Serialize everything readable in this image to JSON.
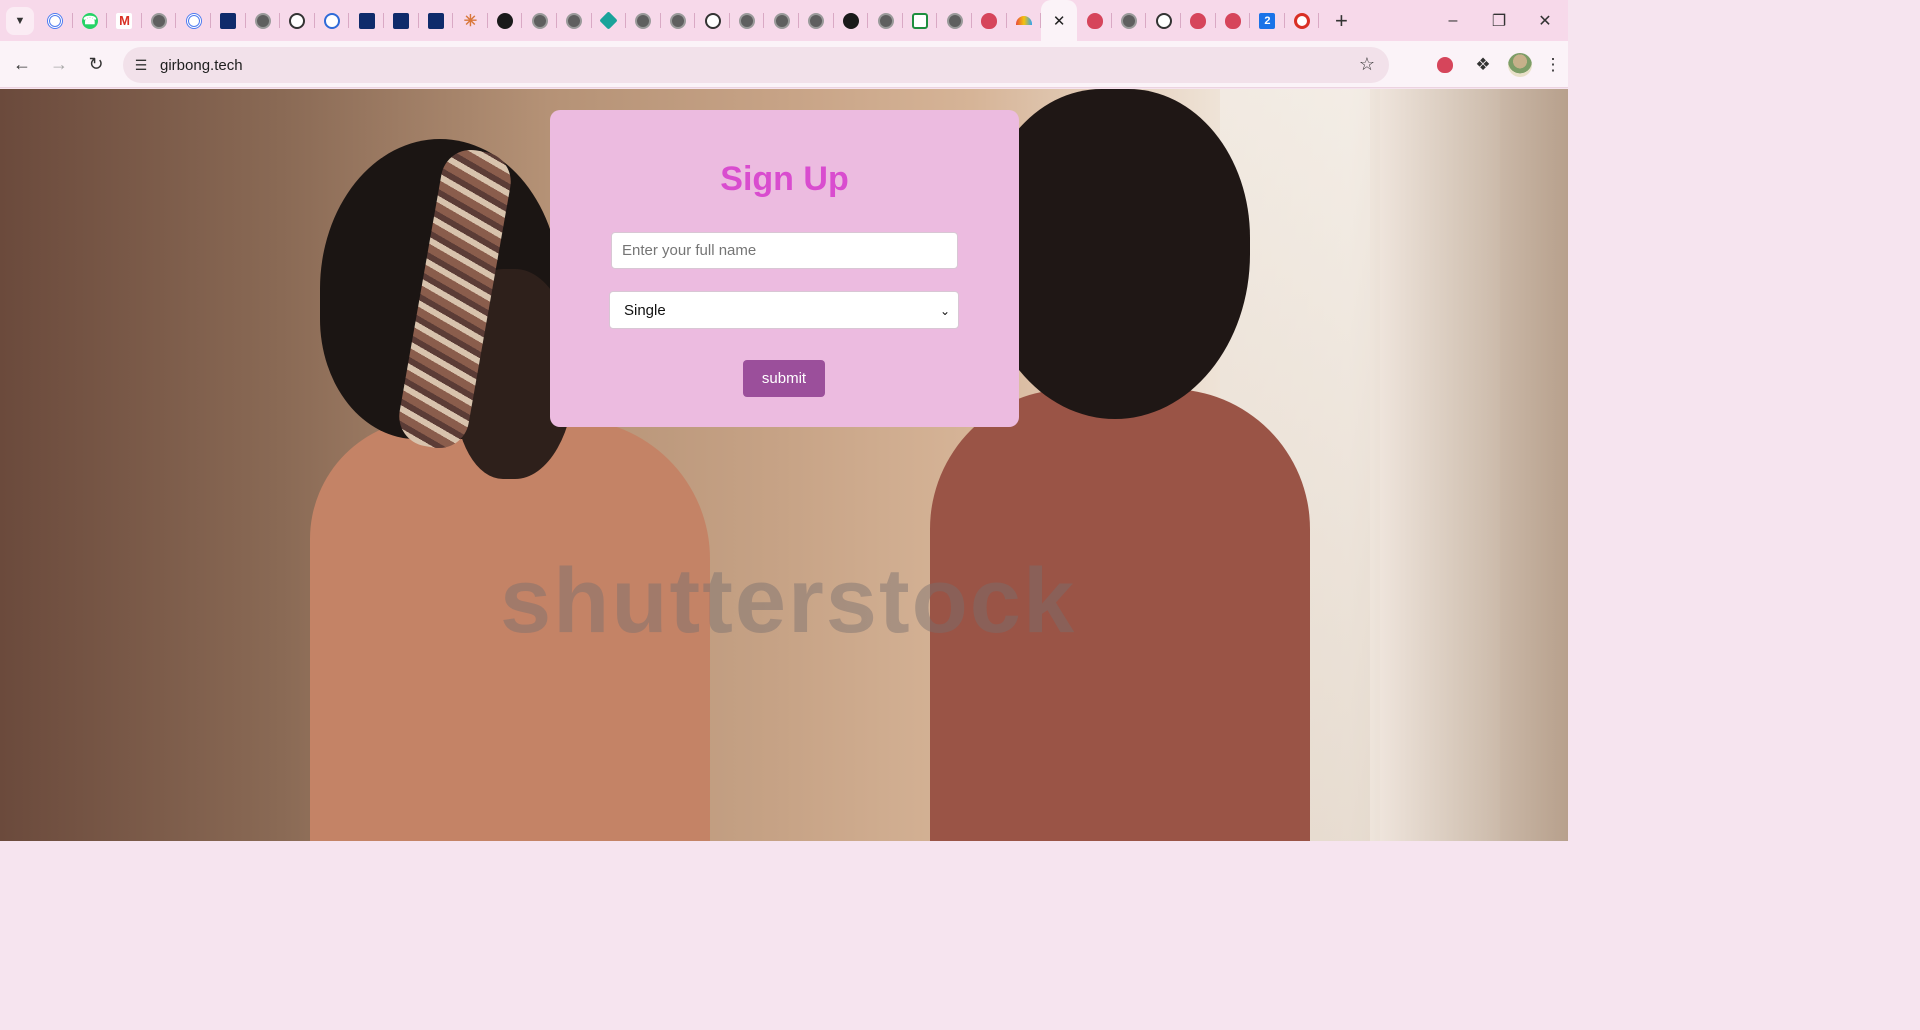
{
  "browser": {
    "url": "girbong.tech",
    "tab_icons": [
      "ring-icon",
      "whatsapp-icon",
      "gmail-icon",
      "globe-icon",
      "ring-icon",
      "dark-square-icon",
      "globe-icon",
      "chatgpt-icon",
      "refresh-icon",
      "dark-square-icon",
      "dark-square-icon",
      "dark-square-icon",
      "star-icon",
      "github-icon",
      "globe-icon",
      "globe-icon",
      "diamond-icon",
      "globe-icon",
      "globe-icon",
      "chatgpt-icon",
      "globe-icon",
      "globe-icon",
      "chrome-icon",
      "github-icon",
      "globe-icon",
      "meet-icon",
      "globe-icon",
      "blob-icon",
      "rainbow-icon",
      "active-close",
      "blob-icon",
      "globe-icon",
      "chatgpt-icon",
      "blob-icon",
      "blob-icon",
      "calendar-icon",
      "record-icon"
    ],
    "calendar_day": "2"
  },
  "page": {
    "watermark": "shutterstock"
  },
  "signup": {
    "title": "Sign Up",
    "name_placeholder": "Enter your full name",
    "name_value": "",
    "status_selected": "Single",
    "submit_label": "submit"
  },
  "colors": {
    "card_bg": "#ecbbe0",
    "title": "#d94ccf",
    "button": "#9b4f9b"
  }
}
